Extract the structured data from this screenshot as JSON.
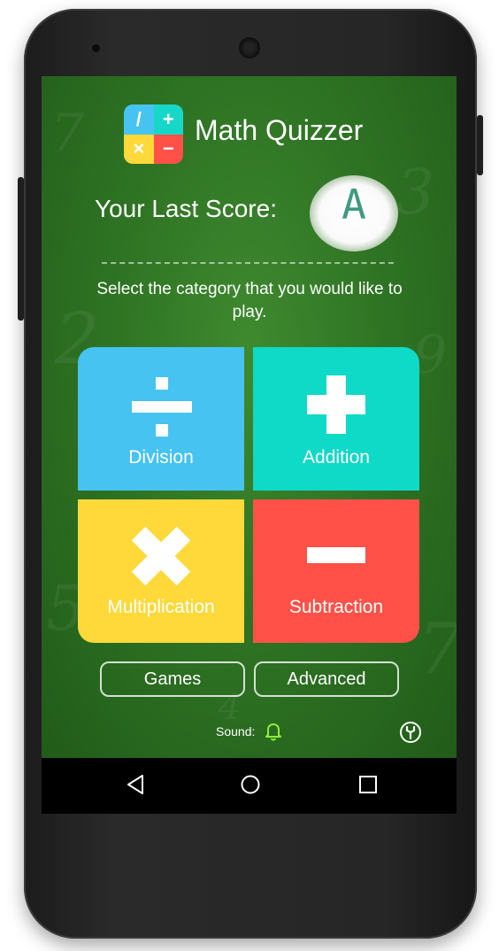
{
  "app": {
    "title": "Math Quizzer",
    "logo_symbols": [
      "/",
      "+",
      "×",
      "−"
    ],
    "logo_colors": [
      "#46c3f1",
      "#17d8c8",
      "#ffd93a",
      "#ff5148"
    ]
  },
  "score": {
    "label": "Your Last Score:",
    "grade": "A"
  },
  "instructions": "Select the category that you would like to play.",
  "categories": [
    {
      "label": "Division",
      "icon": "division-icon",
      "color": "#46c3f1"
    },
    {
      "label": "Addition",
      "icon": "plus-icon",
      "color": "#0fd9c7"
    },
    {
      "label": "Multiplication",
      "icon": "multiply-icon",
      "color": "#ffd93a"
    },
    {
      "label": "Subtraction",
      "icon": "minus-icon",
      "color": "#ff5148"
    }
  ],
  "buttons": {
    "games": "Games",
    "advanced": "Advanced"
  },
  "sound": {
    "label": "Sound:",
    "icon": "bell-icon",
    "icon_color": "#8ef03a"
  },
  "settings_icon": "wrench-icon",
  "navbar": {
    "icons": [
      "back-triangle-icon",
      "home-circle-icon",
      "recents-square-icon"
    ]
  },
  "colors": {
    "board": "#2f7424",
    "navbar": "#000000"
  }
}
